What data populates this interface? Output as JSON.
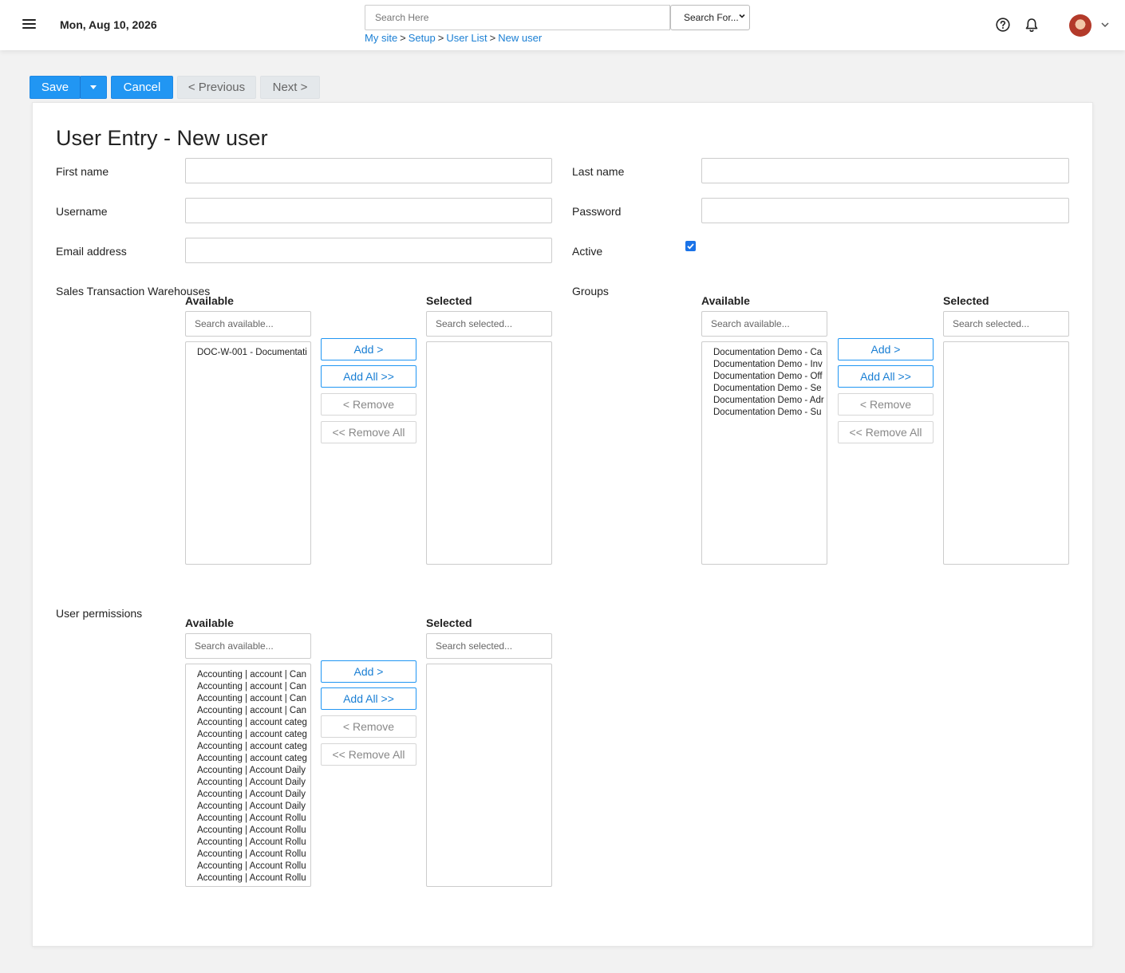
{
  "header": {
    "date": "Mon, Aug 10, 2026",
    "search_placeholder": "Search Here",
    "search_scope": "Search For...",
    "breadcrumb": [
      "My site",
      "Setup",
      "User List",
      "New user"
    ],
    "breadcrumb_sep": ">"
  },
  "toolbar": {
    "save": "Save",
    "cancel": "Cancel",
    "previous": "< Previous",
    "next": "Next >"
  },
  "form": {
    "title": "User Entry - New user",
    "first_name_label": "First name",
    "last_name_label": "Last name",
    "username_label": "Username",
    "password_label": "Password",
    "email_label": "Email address",
    "active_label": "Active",
    "active_checked": true,
    "warehouses_label": "Sales Transaction Warehouses",
    "groups_label": "Groups",
    "permissions_label": "User permissions"
  },
  "duallist": {
    "available": "Available",
    "selected": "Selected",
    "search_available": "Search available...",
    "search_selected": "Search selected...",
    "add": "Add >",
    "add_all": "Add All >>",
    "remove": "< Remove",
    "remove_all": "<< Remove All"
  },
  "warehouses": {
    "available": [
      "DOC-W-001 - Documentati"
    ]
  },
  "groups": {
    "available": [
      "Documentation Demo - Ca",
      "Documentation Demo - Inv",
      "Documentation Demo - Off",
      "Documentation Demo - Se",
      "Documentation Demo - Adr",
      "Documentation Demo - Su"
    ]
  },
  "permissions": {
    "available": [
      "Accounting | account | Can",
      "Accounting | account | Can",
      "Accounting | account | Can",
      "Accounting | account | Can",
      "Accounting | account categ",
      "Accounting | account categ",
      "Accounting | account categ",
      "Accounting | account categ",
      "Accounting | Account Daily",
      "Accounting | Account Daily",
      "Accounting | Account Daily",
      "Accounting | Account Daily",
      "Accounting | Account Rollu",
      "Accounting | Account Rollu",
      "Accounting | Account Rollu",
      "Accounting | Account Rollu",
      "Accounting | Account Rollu",
      "Accounting | Account Rollu"
    ]
  }
}
